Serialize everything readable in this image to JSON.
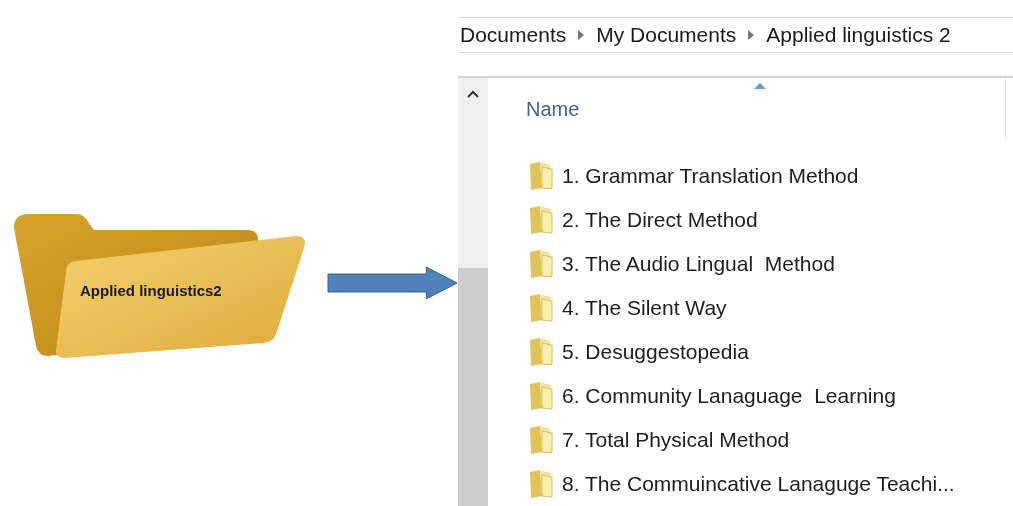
{
  "folder_graphic": {
    "label": "Applied linguistics2"
  },
  "explorer": {
    "breadcrumb": [
      {
        "label": "Documents"
      },
      {
        "label": "My Documents"
      },
      {
        "label": "Applied linguistics 2"
      }
    ],
    "column_header": "Name",
    "items": [
      {
        "name": "1. Grammar Translation Method"
      },
      {
        "name": "2. The Direct Method"
      },
      {
        "name": "3. The Audio Lingual  Method"
      },
      {
        "name": "4. The Silent Way"
      },
      {
        "name": "5. Desuggestopedia"
      },
      {
        "name": "6. Community Lanaguage  Learning"
      },
      {
        "name": "7. Total Physical Method"
      },
      {
        "name": "8. The Commuincative Lanaguge Teachi..."
      }
    ]
  }
}
